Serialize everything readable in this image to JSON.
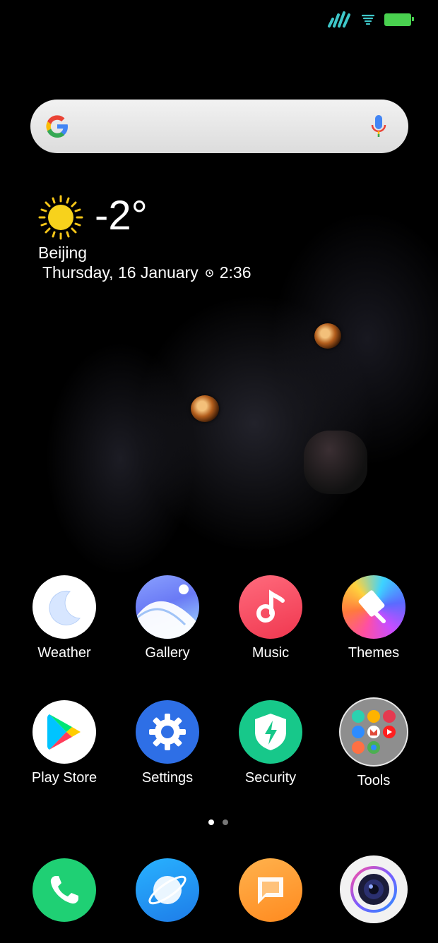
{
  "status_bar": {
    "signal_icon": "signal-icon",
    "wifi_icon": "wifi-icon",
    "battery_icon": "battery-icon",
    "accent_color": "#3ec7c9",
    "battery_color": "#49d14f"
  },
  "search_bar": {
    "logo": "google-g-icon",
    "mic": "microphone-icon"
  },
  "weather_widget": {
    "condition_icon": "sun-icon",
    "temperature": "-2°",
    "city": "Beijing",
    "date": "Thursday, 16 January",
    "alarm_icon": "alarm-clock-icon",
    "time": "2:36"
  },
  "apps_row1": [
    {
      "label": "Weather",
      "icon": "weather-moon-icon"
    },
    {
      "label": "Gallery",
      "icon": "gallery-icon"
    },
    {
      "label": "Music",
      "icon": "music-note-icon"
    },
    {
      "label": "Themes",
      "icon": "themes-brush-icon"
    }
  ],
  "apps_row2": [
    {
      "label": "Play Store",
      "icon": "play-store-icon"
    },
    {
      "label": "Settings",
      "icon": "gear-icon"
    },
    {
      "label": "Security",
      "icon": "shield-bolt-icon"
    },
    {
      "label": "Tools",
      "icon": "folder-icon"
    }
  ],
  "page_indicator": {
    "pages": 2,
    "current": 1,
    "active_color": "#ffffff",
    "inactive_color": "#777777"
  },
  "dock": [
    {
      "icon": "phone-icon"
    },
    {
      "icon": "browser-icon"
    },
    {
      "icon": "messages-icon"
    },
    {
      "icon": "camera-icon"
    }
  ]
}
